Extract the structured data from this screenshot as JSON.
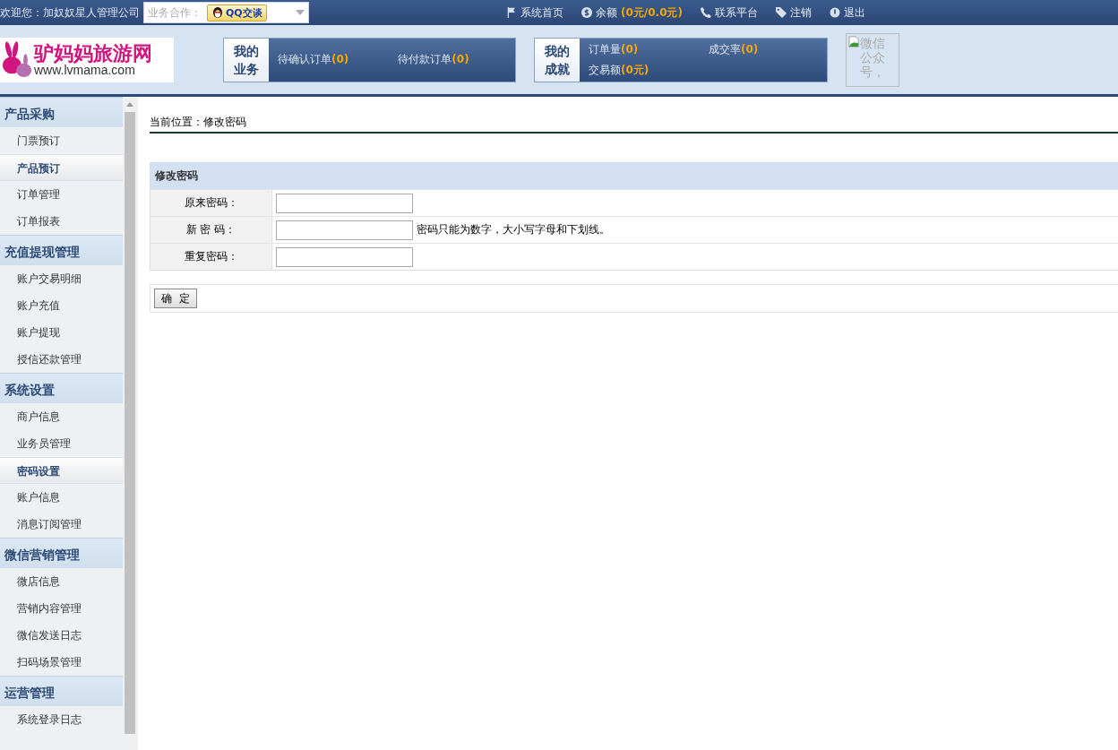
{
  "top_bar": {
    "welcome": "欢迎您：加奴奴星人管理公司",
    "partner_label": "业务合作：",
    "qq_button": "QQ交谈",
    "links": [
      {
        "kind": "flag",
        "label": "系统首页"
      },
      {
        "kind": "coin",
        "label": "余额",
        "value": "(0元/0.0元)"
      },
      {
        "kind": "phone",
        "label": "联系平台"
      },
      {
        "kind": "tag",
        "label": "注销"
      },
      {
        "kind": "power",
        "label": "退出"
      }
    ]
  },
  "header": {
    "logo_title": "驴妈妈旅游网",
    "logo_url": "www.lvmama.com",
    "panels": [
      {
        "title": "我的业务",
        "stats": [
          {
            "label": "待确认订单",
            "value": "(0)"
          },
          {
            "label": "待付款订单",
            "value": "(0)"
          }
        ]
      },
      {
        "title": "我的成就",
        "stats": [
          {
            "label": "订单量",
            "value": "(0)"
          },
          {
            "label": "成交率",
            "value": "(0)"
          },
          {
            "label": "交易额",
            "value": "(0元)"
          }
        ]
      }
    ],
    "qr_alt": "微信公众号，"
  },
  "sidebar": [
    {
      "title": "产品采购",
      "items": [
        {
          "label": "门票预订",
          "selected": false
        },
        {
          "label": "产品预订",
          "selected": true
        },
        {
          "label": "订单管理",
          "selected": false
        },
        {
          "label": "订单报表",
          "selected": false
        }
      ]
    },
    {
      "title": "充值提现管理",
      "items": [
        {
          "label": "账户交易明细",
          "selected": false
        },
        {
          "label": "账户充值",
          "selected": false
        },
        {
          "label": "账户提现",
          "selected": false
        },
        {
          "label": "授信还款管理",
          "selected": false
        }
      ]
    },
    {
      "title": "系统设置",
      "items": [
        {
          "label": "商户信息",
          "selected": false
        },
        {
          "label": "业务员管理",
          "selected": false
        },
        {
          "label": "密码设置",
          "selected": true
        },
        {
          "label": "账户信息",
          "selected": false
        },
        {
          "label": "消息订阅管理",
          "selected": false
        }
      ]
    },
    {
      "title": "微信营销管理",
      "items": [
        {
          "label": "微店信息",
          "selected": false
        },
        {
          "label": "营销内容管理",
          "selected": false
        },
        {
          "label": "微信发送日志",
          "selected": false
        },
        {
          "label": "扫码场景管理",
          "selected": false
        }
      ]
    },
    {
      "title": "运营管理",
      "items": [
        {
          "label": "系统登录日志",
          "selected": false
        }
      ]
    }
  ],
  "breadcrumb": "当前位置：修改密码",
  "form": {
    "title": "修改密码",
    "fields": [
      {
        "label": "原来密码："
      },
      {
        "label": "新 密 码：",
        "hint": "密码只能为数字，大小写字母和下划线。"
      },
      {
        "label": "重复密码："
      }
    ],
    "submit": "确  定"
  }
}
